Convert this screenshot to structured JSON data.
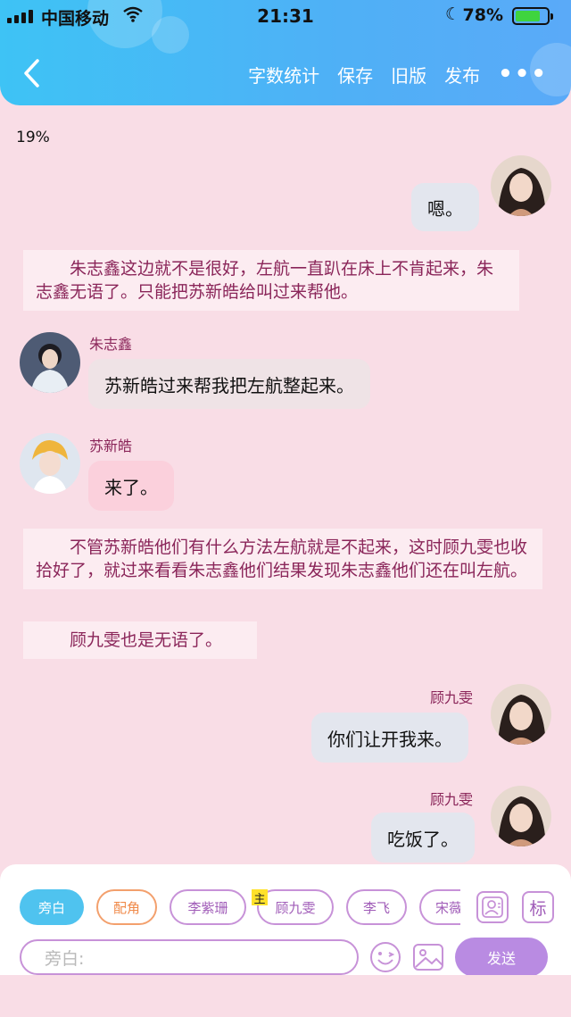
{
  "status_bar": {
    "carrier": "中国移动",
    "time": "21:31",
    "battery": "78%",
    "battery_level": 0.78
  },
  "header": {
    "back_icon": "chevron-left-icon",
    "actions": [
      "字数统计",
      "保存",
      "旧版",
      "发布"
    ],
    "more_icon": "more-dots-icon",
    "more_label": "•••"
  },
  "progress": "19%",
  "messages": [
    {
      "type": "bubble",
      "side": "right",
      "speaker": "",
      "text": "嗯。"
    },
    {
      "type": "narration",
      "text": "朱志鑫这边就不是很好，左航一直趴在床上不肯起来，朱志鑫无语了。只能把苏新皓给叫过来帮他。"
    },
    {
      "type": "bubble",
      "side": "left",
      "speaker": "朱志鑫",
      "text": "苏新皓过来帮我把左航整起来。"
    },
    {
      "type": "bubble",
      "side": "left",
      "speaker": "苏新皓",
      "text": "来了。"
    },
    {
      "type": "narration",
      "text": "不管苏新皓他们有什么方法左航就是不起来，这时顾九雯也收拾好了，就过来看看朱志鑫他们结果发现朱志鑫他们还在叫左航。"
    },
    {
      "type": "narration",
      "text": "顾九雯也是无语了。"
    },
    {
      "type": "bubble",
      "side": "right",
      "speaker": "顾九雯",
      "text": "你们让开我来。"
    },
    {
      "type": "bubble",
      "side": "right",
      "speaker": "顾九雯",
      "text": "吃饭了。"
    }
  ],
  "roles": {
    "narrator": "旁白",
    "supporting": "配角",
    "characters": [
      "李紫珊",
      "顾九雯",
      "李飞",
      "宋薇"
    ],
    "main_badge": "主",
    "contact_icon": "contact-card-icon",
    "tag_label": "标"
  },
  "composer": {
    "placeholder": "旁白:",
    "emoji_icon": "emoji-icon",
    "image_icon": "image-icon",
    "send_label": "发送"
  },
  "colors": {
    "header_gradient_start": "#3ec3f5",
    "header_gradient_end": "#5aaaf8",
    "page_bg": "#f9dde6",
    "narration_text": "#8a2559",
    "send_button": "#b98be2",
    "role_border": "#c792d8"
  }
}
